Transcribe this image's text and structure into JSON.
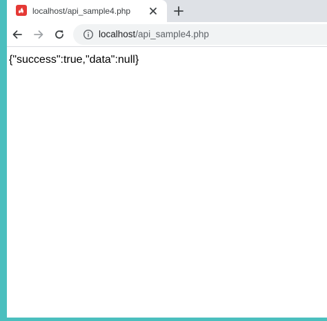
{
  "tab": {
    "title": "localhost/api_sample4.php",
    "favicon": "code-igniter-icon",
    "close_icon": "close-icon"
  },
  "new_tab_icon": "plus-icon",
  "toolbar": {
    "back_icon": "back-arrow-icon",
    "forward_icon": "forward-arrow-icon",
    "reload_icon": "reload-icon",
    "info_icon": "info-icon",
    "url_host": "localhost",
    "url_path": "/api_sample4.php"
  },
  "page": {
    "body_text": "{\"success\":true,\"data\":null}"
  },
  "colors": {
    "frame": "#4bbfbe",
    "tabstrip": "#dee1e6",
    "favicon": "#e53935",
    "omnibox": "#f1f3f4"
  }
}
